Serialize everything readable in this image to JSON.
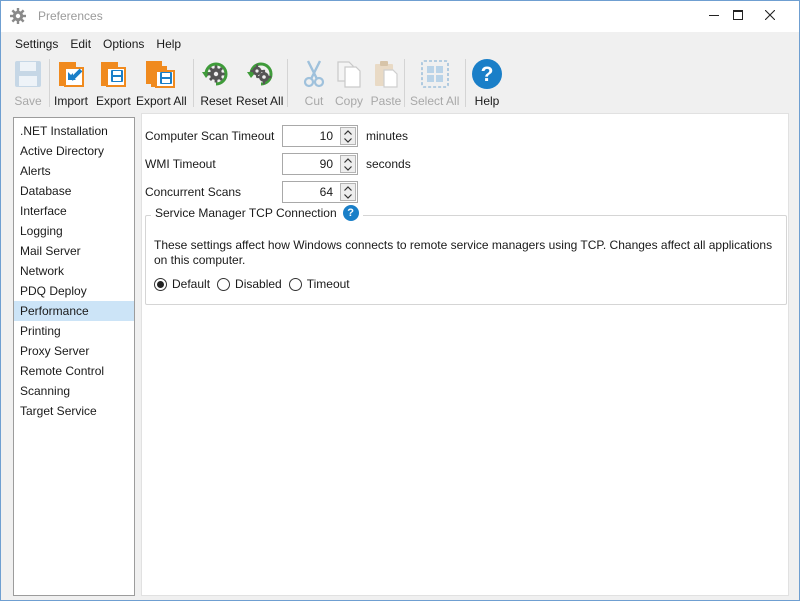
{
  "window": {
    "title": "Preferences",
    "icons": {
      "app": "gear-icon",
      "minimize": "minimize-icon",
      "maximize": "maximize-icon",
      "close": "close-icon"
    }
  },
  "menu": [
    "Settings",
    "Edit",
    "Options",
    "Help"
  ],
  "toolbar": {
    "save": "Save",
    "import": "Import",
    "export": "Export",
    "export_all": "Export All",
    "reset": "Reset",
    "reset_all": "Reset All",
    "cut": "Cut",
    "copy": "Copy",
    "paste": "Paste",
    "select_all": "Select All",
    "help": "Help",
    "disabled": [
      "Save",
      "Cut",
      "Copy",
      "Paste",
      "Select All"
    ]
  },
  "categories": [
    ".NET Installation",
    "Active Directory",
    "Alerts",
    "Database",
    "Interface",
    "Logging",
    "Mail Server",
    "Network",
    "PDQ Deploy",
    "Performance",
    "Printing",
    "Proxy Server",
    "Remote Control",
    "Scanning",
    "Target Service"
  ],
  "selected_category": "Performance",
  "fields": {
    "computer_scan_timeout": {
      "label": "Computer Scan Timeout",
      "value": "10",
      "unit": "minutes"
    },
    "wmi_timeout": {
      "label": "WMI Timeout",
      "value": "90",
      "unit": "seconds"
    },
    "concurrent_scans": {
      "label": "Concurrent Scans",
      "value": "64"
    }
  },
  "tcp_group": {
    "title": "Service Manager TCP Connection",
    "description": "These settings affect how Windows connects to remote service managers using TCP. Changes affect all applications on this computer.",
    "options": [
      "Default",
      "Disabled",
      "Timeout"
    ],
    "selected": "Default"
  },
  "colors": {
    "accent": "#1a7fc8",
    "orange": "#f08a1e",
    "green": "#3f9b3a",
    "selection": "#cce4f7"
  }
}
